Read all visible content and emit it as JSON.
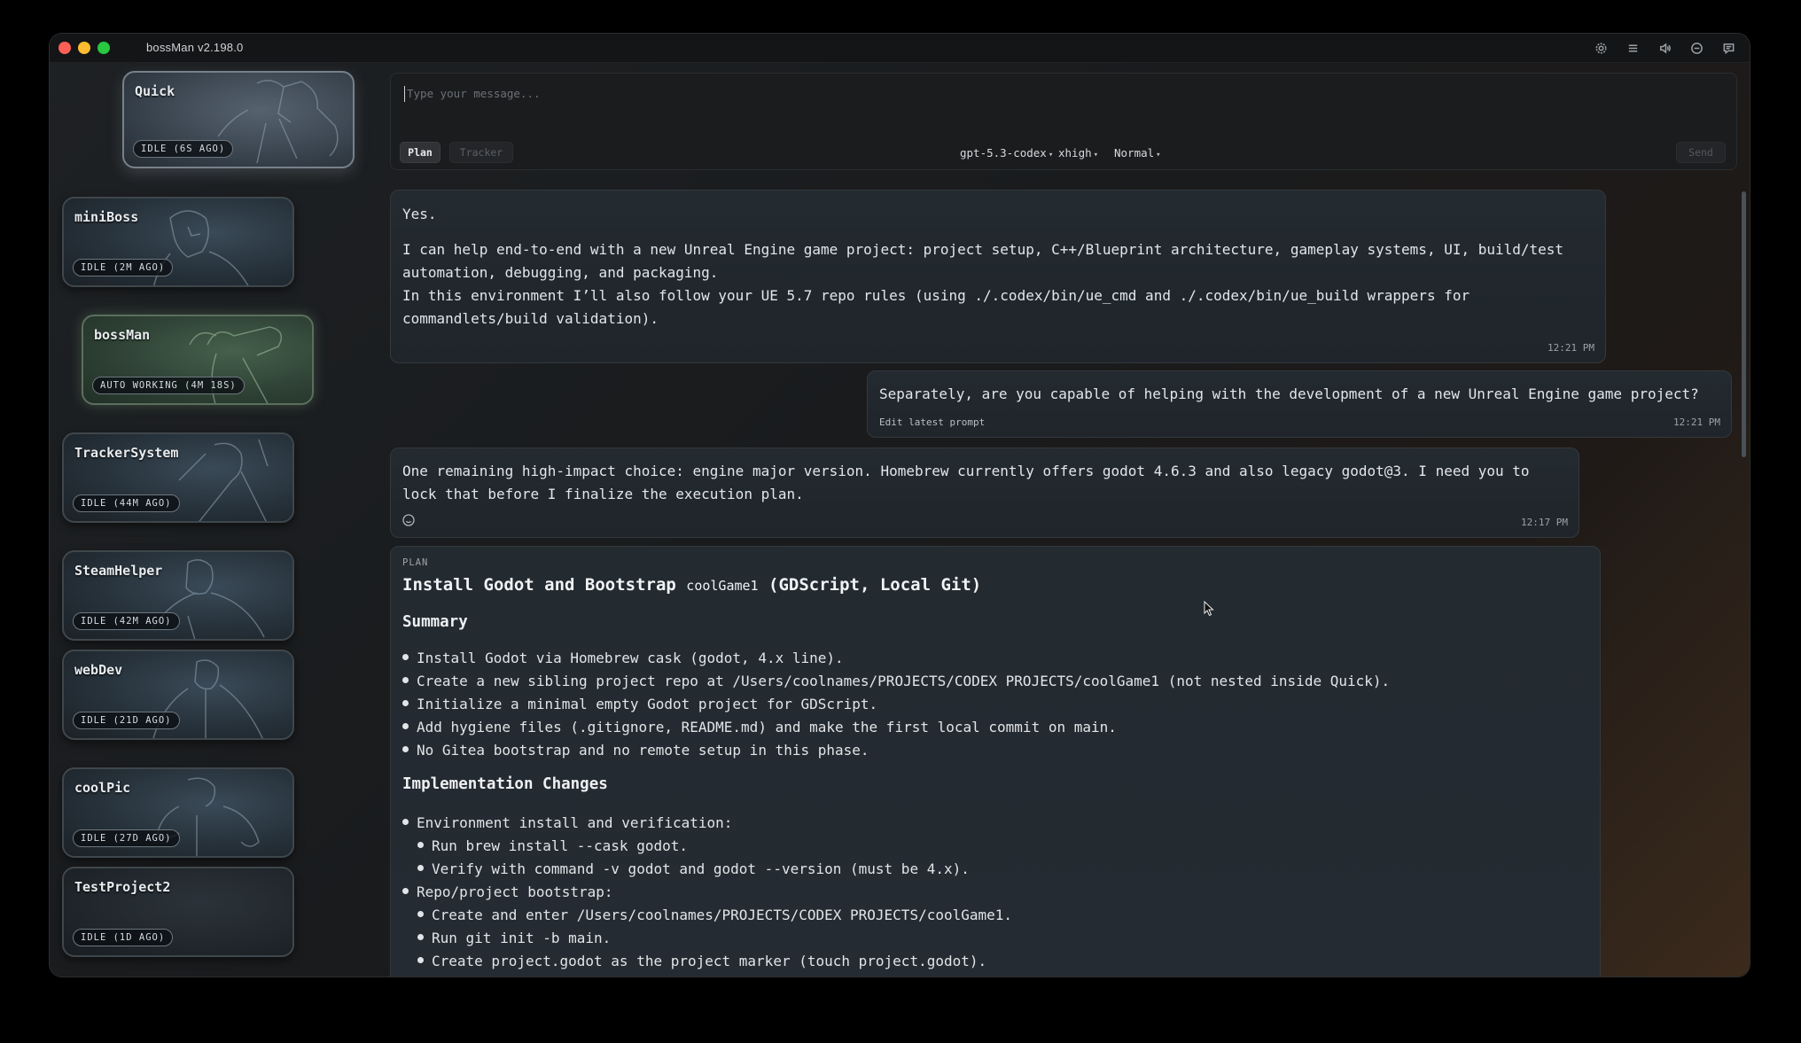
{
  "app": {
    "title": "bossMan v2.198.0"
  },
  "titlebar_icons": [
    "gear-icon",
    "menu-icon",
    "speaker-icon",
    "minus-circle-icon",
    "chat-icon"
  ],
  "sessions": [
    {
      "name": "Quick",
      "status": "IDLE (6S AGO)"
    },
    {
      "name": "miniBoss",
      "status": "IDLE (2M AGO)"
    },
    {
      "name": "bossMan",
      "status": "AUTO WORKING (4M 18S)"
    },
    {
      "name": "TrackerSystem",
      "status": "IDLE (44M AGO)"
    },
    {
      "name": "SteamHelper",
      "status": "IDLE (42M AGO)"
    },
    {
      "name": "webDev",
      "status": "IDLE (21D AGO)"
    },
    {
      "name": "coolPic",
      "status": "IDLE (27D AGO)"
    },
    {
      "name": "TestProject2",
      "status": "IDLE (1D AGO)"
    }
  ],
  "composer": {
    "placeholder": "Type your message...",
    "plan_label": "Plan",
    "tracker_label": "Tracker",
    "model": "gpt-5.3-codex",
    "effort": "xhigh",
    "mode": "Normal",
    "send_label": "Send"
  },
  "messages": {
    "m1": {
      "line1": "Yes.",
      "line2": "I can help end-to-end with a new Unreal Engine game project: project setup, C++/Blueprint architecture, gameplay systems, UI, build/test automation, debugging, and packaging.",
      "line3": "In this environment I’ll also follow your UE 5.7 repo rules (using ./.codex/bin/ue_cmd and ./.codex/bin/ue_build wrappers for commandlets/build validation).",
      "time": "12:21 PM"
    },
    "m2": {
      "text": "Separately, are you capable of helping with the development of a new Unreal Engine game project?",
      "edit": "Edit latest prompt",
      "time": "12:21 PM"
    },
    "m3": {
      "text": "One remaining high-impact choice: engine major version. Homebrew currently offers godot 4.6.3 and also legacy godot@3. I need you to lock that before I finalize the execution plan.",
      "time": "12:17 PM"
    }
  },
  "plan": {
    "tag": "PLAN",
    "title_a": "Install Godot and Bootstrap ",
    "title_code": "coolGame1",
    "title_b": " (GDScript, Local Git)",
    "summary_heading": "Summary",
    "summary": [
      "Install Godot via Homebrew cask (godot, 4.x line).",
      "Create a new sibling project repo at /Users/coolnames/PROJECTS/CODEX PROJECTS/coolGame1 (not nested inside Quick).",
      "Initialize a minimal empty Godot project for GDScript.",
      "Add hygiene files (.gitignore, README.md) and make the first local commit on main.",
      "No Gitea bootstrap and no remote setup in this phase."
    ],
    "impl_heading": "Implementation Changes",
    "impl": [
      {
        "text": "Environment install and verification:",
        "sub": false
      },
      {
        "text": "Run brew install --cask godot.",
        "sub": true
      },
      {
        "text": "Verify with command -v godot and godot --version (must be 4.x).",
        "sub": true
      },
      {
        "text": "Repo/project bootstrap:",
        "sub": false
      },
      {
        "text": "Create and enter /Users/coolnames/PROJECTS/CODEX PROJECTS/coolGame1.",
        "sub": true
      },
      {
        "text": "Run git init -b main.",
        "sub": true
      },
      {
        "text": "Create project.godot as the project marker (touch project.godot).",
        "sub": true
      }
    ]
  }
}
